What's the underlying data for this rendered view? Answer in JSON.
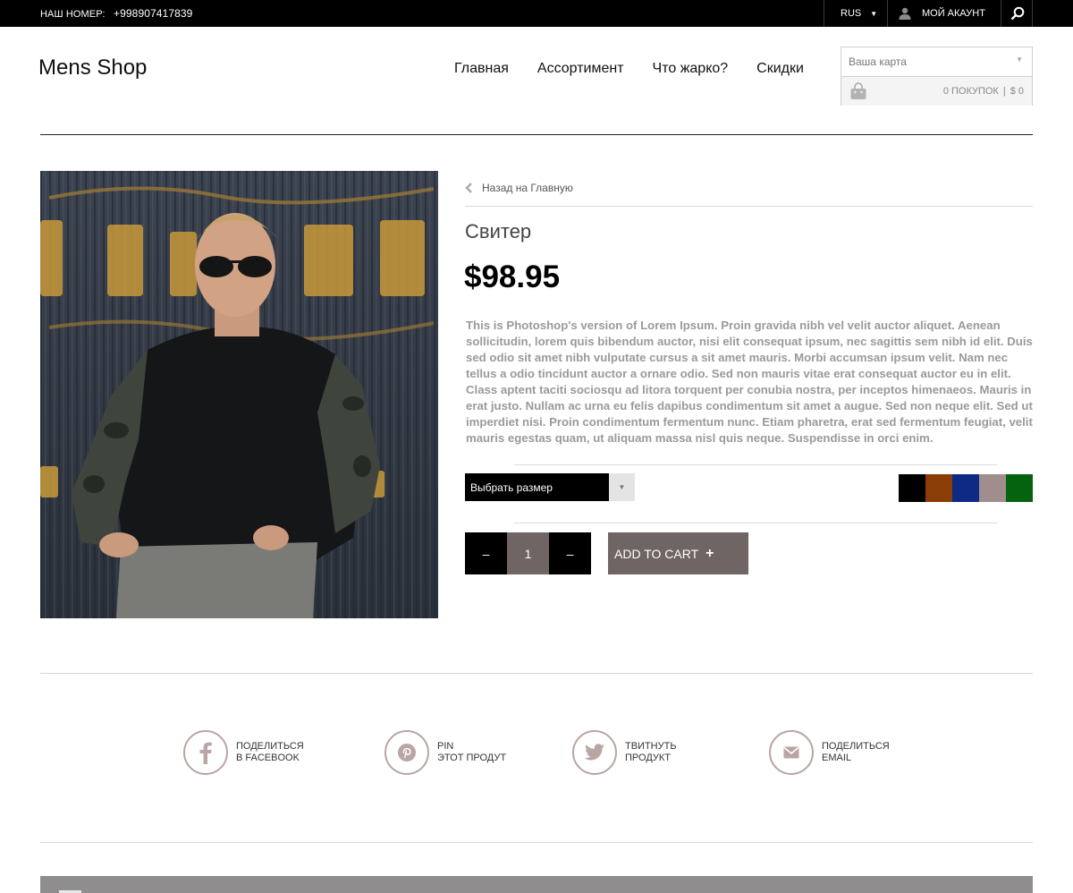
{
  "topbar": {
    "phone_label": "НАШ НОМЕР:",
    "phone_number": "+998907417839",
    "language": "RUS",
    "account_label": "МОЙ АКАУНТ"
  },
  "header": {
    "logo": "Mens Shop",
    "nav": [
      "Главная",
      "Ассортимент",
      "Что жарко?",
      "Скидки"
    ],
    "cart": {
      "placeholder": "Ваша карта",
      "items": "0 ПОКУПОК",
      "separator": "|",
      "total": "$ 0"
    }
  },
  "product": {
    "back_link": "Назад на Главную",
    "title": "Свитер",
    "price": "$98.95",
    "description": "This is Photoshop's version  of Lorem Ipsum. Proin gravida nibh vel velit auctor aliquet. Aenean sollicitudin, lorem quis bibendum auctor, nisi elit consequat ipsum, nec sagittis sem nibh id elit. Duis sed odio sit amet nibh vulputate cursus a sit amet mauris. Morbi accumsan ipsum velit. Nam nec tellus a odio tincidunt auctor a ornare odio. Sed non  mauris vitae erat consequat auctor eu in elit. Class aptent taciti sociosqu ad litora torquent per conubia nostra, per inceptos himenaeos. Mauris in erat justo. Nullam ac urna eu felis dapibus condimentum sit amet a augue. Sed non neque elit. Sed ut imperdiet nisi. Proin condimentum fermentum nunc. Etiam pharetra, erat sed fermentum feugiat, velit mauris egestas quam, ut aliquam massa nisl quis neque. Suspendisse in orci enim.",
    "size_select": "Выбрать размер",
    "colors": [
      "#000000",
      "#8a3d06",
      "#0e2a85",
      "#a08e8e",
      "#05620f"
    ],
    "quantity": {
      "minus": "–",
      "value": "1",
      "plus": "–"
    },
    "add_to_cart": "ADD TO CART",
    "add_icon": "+"
  },
  "share": [
    {
      "icon": "facebook-icon",
      "line1": "ПОДЕЛИТЬСЯ",
      "line2": "В FACEBOOK"
    },
    {
      "icon": "pinterest-icon",
      "line1": "PIN",
      "line2": "ЭТОТ ПРОДУТ"
    },
    {
      "icon": "twitter-icon",
      "line1": "ТВИТНУТЬ",
      "line2": "ПРОДУКТ"
    },
    {
      "icon": "email-icon",
      "line1": "ПОДЕЛИТЬСЯ",
      "line2": "EMAIL"
    }
  ]
}
